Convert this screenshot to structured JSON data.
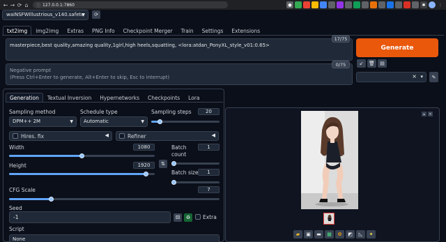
{
  "browser": {
    "url": "127.0.0.1:7860",
    "nav_back": "←",
    "nav_forward": "→",
    "nav_reload": "⟳",
    "nav_home": "⌂"
  },
  "model": {
    "selected": "waiNSFWIllustrious_v140.safete",
    "refresh_icon": "⟳"
  },
  "top_tabs": [
    "txt2img",
    "img2img",
    "Extras",
    "PNG Info",
    "Checkpoint Merger",
    "Train",
    "Settings",
    "Extensions"
  ],
  "prompt": {
    "text": "masterpiece,best quality,amazing quality,1girl,high heels,squatting, <lora:atdan_PonyXL_style_v01:0.65>",
    "token_count": "17/75"
  },
  "negative_prompt": {
    "placeholder_line1": "Negative prompt",
    "placeholder_line2": "(Press Ctrl+Enter to generate, Alt+Enter to skip, Esc to interrupt)",
    "token_count": "0/75"
  },
  "generate_label": "Generate",
  "styles": {
    "clear_icon": "×",
    "dropdown_icon": "▾"
  },
  "sub_tabs": [
    "Generation",
    "Textual Inversion",
    "Hypernetworks",
    "Checkpoints",
    "Lora"
  ],
  "generation": {
    "sampling_method_label": "Sampling method",
    "sampling_method_value": "DPM++ 2M",
    "schedule_type_label": "Schedule type",
    "schedule_type_value": "Automatic",
    "sampling_steps_label": "Sampling steps",
    "sampling_steps_value": "20",
    "sampling_steps_fraction": 0.13,
    "hires_fix_label": "Hires. fix",
    "refiner_label": "Refiner",
    "width_label": "Width",
    "width_value": "1080",
    "width_fraction": 0.5,
    "height_label": "Height",
    "height_value": "1920",
    "height_fraction": 0.94,
    "swap_icon": "⇅",
    "batch_count_label": "Batch count",
    "batch_count_value": "1",
    "batch_size_label": "Batch size",
    "batch_size_value": "1",
    "cfg_scale_label": "CFG Scale",
    "cfg_scale_value": "7",
    "cfg_fraction": 0.2,
    "seed_label": "Seed",
    "seed_value": "-1",
    "extra_label": "Extra",
    "script_label": "Script",
    "script_value": "None"
  },
  "colors": {
    "accent_generate": "#ea580c",
    "slider_fill": "#60a5fa",
    "background": "#0b0f19"
  }
}
